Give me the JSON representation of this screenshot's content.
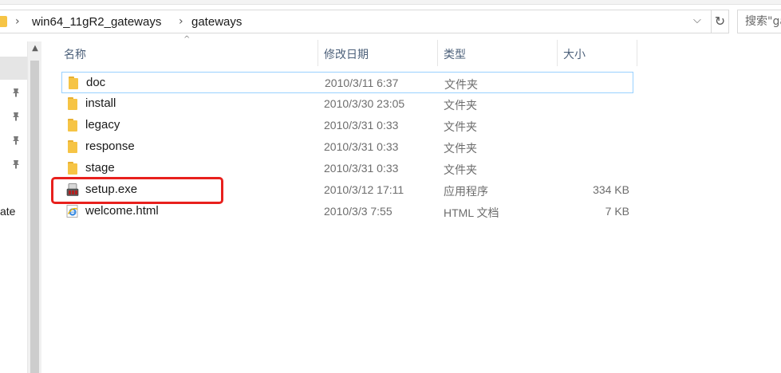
{
  "address_bar": {
    "breadcrumbs": [
      "win64_11gR2_gateways",
      "gateways"
    ],
    "separator": "›",
    "dropdown_icon": "chevron-down-icon",
    "refresh_icon": "refresh-icon"
  },
  "search": {
    "placeholder": "搜索\"gateways\""
  },
  "navigation": {
    "truncated_item": "ate",
    "pinned_icons": 4
  },
  "columns": {
    "name": "名称",
    "date_modified": "修改日期",
    "type": "类型",
    "size": "大小"
  },
  "files": [
    {
      "name": "doc",
      "date": "2010/3/11 6:37",
      "type": "文件夹",
      "size": "",
      "icon": "folder-icon",
      "selected": true
    },
    {
      "name": "install",
      "date": "2010/3/30 23:05",
      "type": "文件夹",
      "size": "",
      "icon": "folder-icon",
      "selected": false
    },
    {
      "name": "legacy",
      "date": "2010/3/31 0:33",
      "type": "文件夹",
      "size": "",
      "icon": "folder-icon",
      "selected": false
    },
    {
      "name": "response",
      "date": "2010/3/31 0:33",
      "type": "文件夹",
      "size": "",
      "icon": "folder-icon",
      "selected": false
    },
    {
      "name": "stage",
      "date": "2010/3/31 0:33",
      "type": "文件夹",
      "size": "",
      "icon": "folder-icon",
      "selected": false
    },
    {
      "name": "setup.exe",
      "date": "2010/3/12 17:11",
      "type": "应用程序",
      "size": "334 KB",
      "icon": "setup-exe-icon",
      "selected": false
    },
    {
      "name": "welcome.html",
      "date": "2010/3/3 7:55",
      "type": "HTML 文档",
      "size": "7 KB",
      "icon": "ie-html-icon",
      "selected": false
    }
  ],
  "colors": {
    "selection_border": "#99d1ff",
    "highlight_annotation": "#e8201d",
    "folder": "#f6c445",
    "header_text": "#4c607a"
  }
}
